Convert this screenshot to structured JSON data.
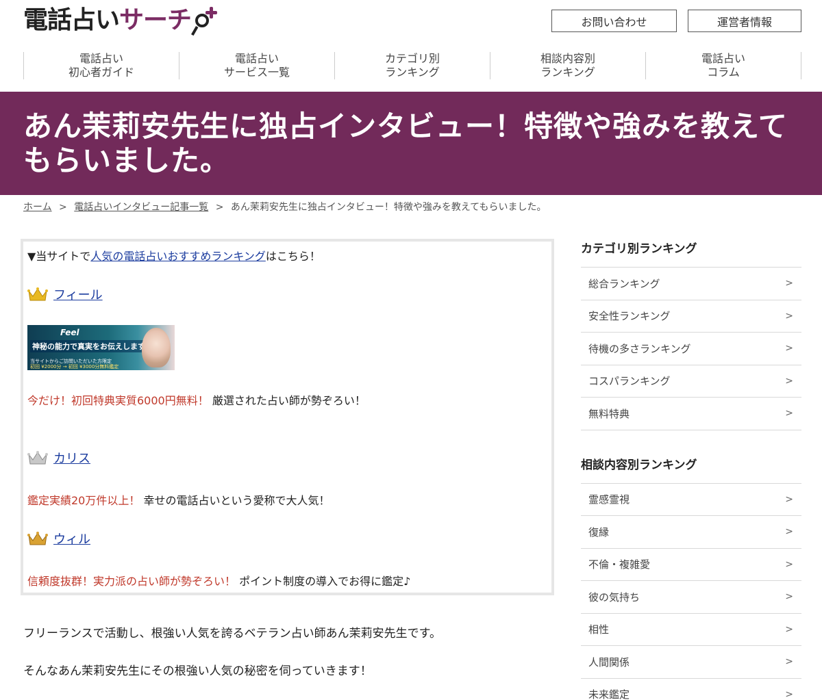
{
  "header": {
    "logo_main": "電話占い",
    "logo_accent": "サーチ",
    "contact_label": "お問い合わせ",
    "operator_label": "運営者情報"
  },
  "nav": [
    {
      "line1": "電話占い",
      "line2": "初心者ガイド"
    },
    {
      "line1": "電話占い",
      "line2": "サービス一覧"
    },
    {
      "line1": "カテゴリ別",
      "line2": "ランキング"
    },
    {
      "line1": "相談内容別",
      "line2": "ランキング"
    },
    {
      "line1": "電話占い",
      "line2": "コラム"
    }
  ],
  "title": {
    "line1": "あん茉莉安先生に独占インタビュー！特徴や強みを教えて",
    "line2": "もらいました。"
  },
  "breadcrumb": {
    "home": "ホーム",
    "list": "電話占いインタビュー記事一覧",
    "current": "あん茉莉安先生に独占インタビュー！特徴や強みを教えてもらいました。",
    "sep": ">"
  },
  "recommend": {
    "intro_prefix": "▼当サイトで",
    "intro_link": "人気の電話占いおすすめランキング",
    "intro_suffix": "はこちら！",
    "items": [
      {
        "name": "フィール",
        "red": "今だけ！初回特典実質6000円無料！",
        "desc": "厳選された占い師が勢ぞろい！",
        "crown": "gold"
      },
      {
        "name": "カリス",
        "red": "鑑定実績20万件以上！",
        "desc": "幸せの電話占いという愛称で大人気！",
        "crown": "silver"
      },
      {
        "name": "ウィル",
        "red": "信頼度抜群！実力派の占い師が勢ぞろい！",
        "desc": "ポイント制度の導入でお得に鑑定♪",
        "crown": "bronze"
      }
    ],
    "banner": {
      "brand": "Feel",
      "headline": "神秘の能力で真実をお伝えします。",
      "note": "当サイトからご訪問いただいた方限定",
      "offer": "初回 ¥2000分 → 初回 ¥3000分無料鑑定"
    }
  },
  "body": {
    "p1": "フリーランスで活動し、根強い人気を誇るベテラン占い師あん茉莉安先生です。",
    "p2": "そんなあん茉莉安先生にその根強い人気の秘密を伺っていきます！"
  },
  "sidebar": {
    "category_title": "カテゴリ別ランキング",
    "category_items": [
      "総合ランキング",
      "安全性ランキング",
      "待機の多さランキング",
      "コスパランキング",
      "無料特典"
    ],
    "consult_title": "相談内容別ランキング",
    "consult_items": [
      "霊感霊視",
      "復縁",
      "不倫・複雑愛",
      "彼の気持ち",
      "相性",
      "人間関係",
      "未来鑑定"
    ],
    "chevron": ">"
  },
  "colors": {
    "brand": "#722a5a",
    "accent_red": "#c0392b",
    "link": "#1a3b9e"
  }
}
